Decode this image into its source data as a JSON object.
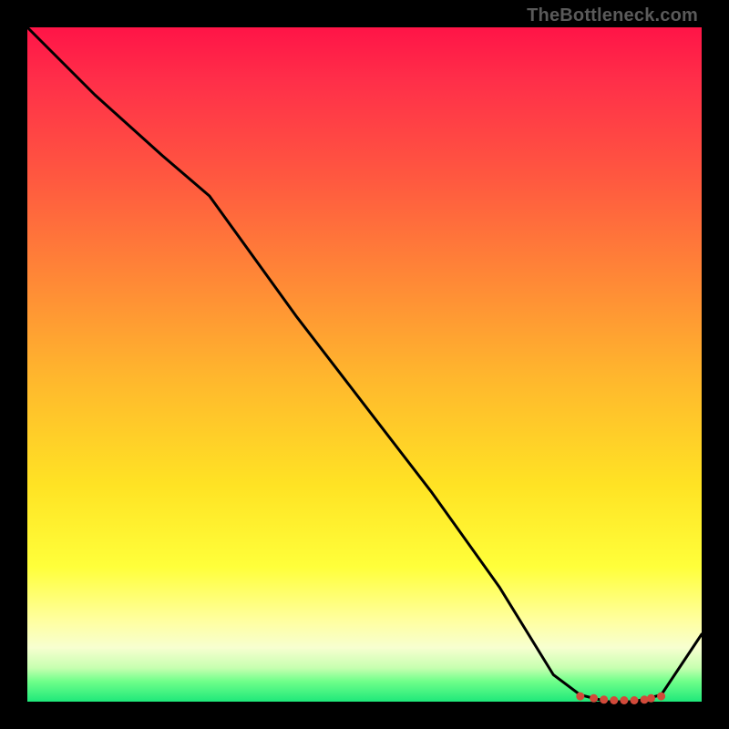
{
  "watermark": "TheBottleneck.com",
  "chart_data": {
    "type": "line",
    "title": "",
    "xlabel": "",
    "ylabel": "",
    "xlim": [
      0,
      100
    ],
    "ylim": [
      0,
      100
    ],
    "curve": {
      "x": [
        0,
        10,
        20,
        27,
        40,
        50,
        60,
        70,
        78,
        82,
        86,
        90,
        94,
        100
      ],
      "y": [
        100,
        90,
        81,
        75,
        57,
        44,
        31,
        17,
        4,
        1,
        0,
        0,
        1,
        10
      ]
    },
    "markers": {
      "x": [
        82,
        84,
        85.5,
        87,
        88.5,
        90,
        91.5,
        92.5,
        94
      ],
      "y": [
        0.8,
        0.5,
        0.3,
        0.2,
        0.2,
        0.2,
        0.3,
        0.5,
        0.8
      ]
    },
    "colors": {
      "curve": "#000000",
      "markers": "#d24a3a",
      "gradient_top": "#ff1447",
      "gradient_bottom": "#1fe87a"
    }
  }
}
